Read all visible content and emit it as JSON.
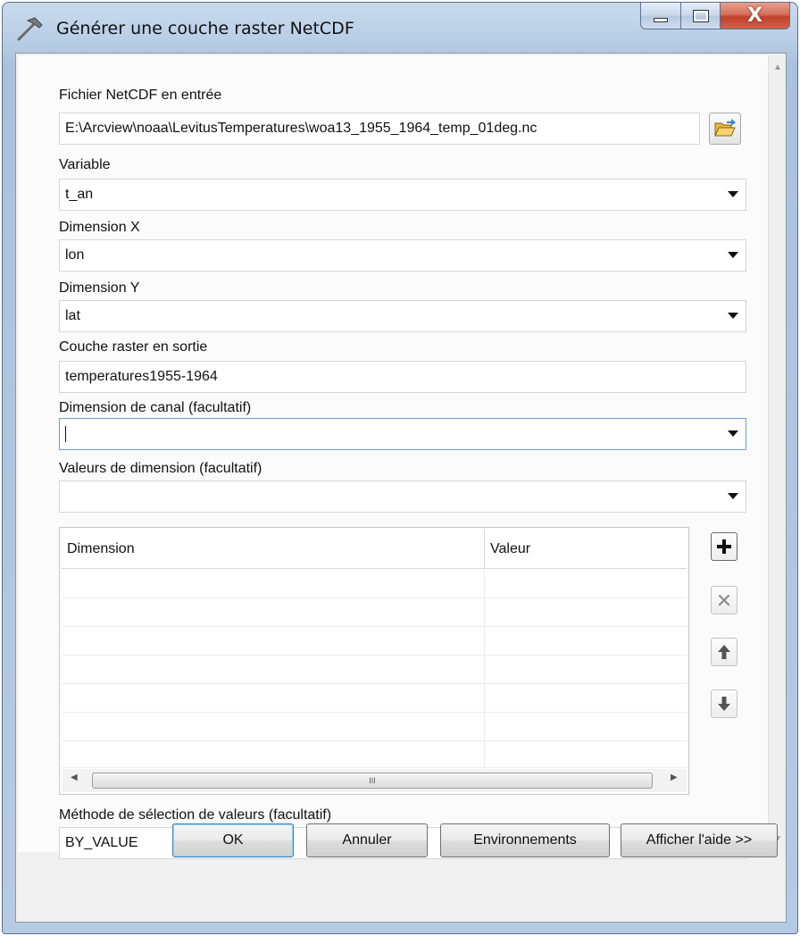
{
  "window": {
    "title": "Générer une couche raster NetCDF",
    "minimize_icon": "minimize-icon",
    "maximize_icon": "maximize-icon",
    "close_glyph": "X"
  },
  "form": {
    "input_file": {
      "label": "Fichier NetCDF en entrée",
      "value": "E:\\Arcview\\noaa\\LevitusTemperatures\\woa13_1955_1964_temp_01deg.nc",
      "browse_icon": "open-folder-icon"
    },
    "variable": {
      "label": "Variable",
      "value": "t_an"
    },
    "dimension_x": {
      "label": "Dimension X",
      "value": "lon"
    },
    "dimension_y": {
      "label": "Dimension Y",
      "value": "lat"
    },
    "output_raster": {
      "label": "Couche raster en sortie",
      "value": "temperatures1955-1964"
    },
    "band_dimension": {
      "label": "Dimension de canal (facultatif)",
      "value": ""
    },
    "dimension_values": {
      "label": "Valeurs de dimension (facultatif)",
      "value": "",
      "table": {
        "columns": [
          "Dimension",
          "Valeur"
        ],
        "rows": [
          [
            "",
            ""
          ],
          [
            "",
            ""
          ],
          [
            "",
            ""
          ],
          [
            "",
            ""
          ],
          [
            "",
            ""
          ],
          [
            "",
            ""
          ],
          [
            "",
            ""
          ]
        ],
        "scroll_thumb_glyph": "III"
      },
      "actions": [
        {
          "name": "add-row-button",
          "glyph": "+"
        },
        {
          "name": "delete-row-button",
          "glyph": "✕"
        },
        {
          "name": "move-up-button",
          "glyph": "🡅"
        },
        {
          "name": "move-down-button",
          "glyph": "🡇"
        }
      ]
    },
    "value_selection_method": {
      "label": "Méthode de sélection de valeurs (facultatif)",
      "value": "BY_VALUE"
    }
  },
  "buttons": {
    "ok": "OK",
    "cancel": "Annuler",
    "environments": "Environnements",
    "show_help": "Afficher l'aide >>"
  }
}
